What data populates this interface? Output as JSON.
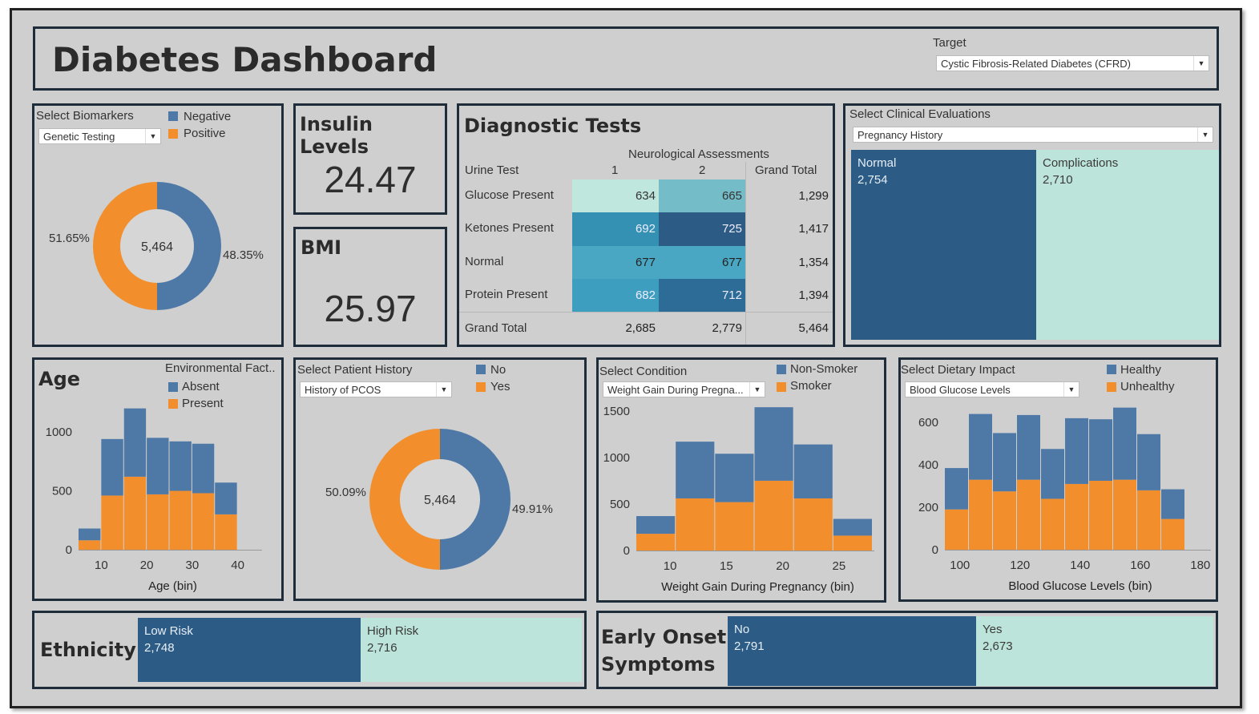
{
  "header": {
    "title": "Diabetes Dashboard",
    "target_label": "Target",
    "target_value": "Cystic Fibrosis-Related Diabetes (CFRD)"
  },
  "biomarkers": {
    "label": "Select Biomarkers",
    "dropdown": "Genetic Testing",
    "legend": [
      "Negative",
      "Positive"
    ],
    "total": "5,464",
    "pct_positive": "51.65%",
    "pct_negative": "48.35%",
    "share_negative": 0.4835
  },
  "insulin": {
    "title": "Insulin Levels",
    "value": "24.47"
  },
  "bmi": {
    "title": "BMI",
    "value": "25.97"
  },
  "diagnostic": {
    "title": "Diagnostic Tests",
    "col_group": "Neurological Assessments",
    "row_header": "Urine Test",
    "cols": [
      "1",
      "2",
      "Grand Total"
    ],
    "rows": [
      {
        "name": "Glucose Present",
        "v1": "634",
        "v2": "665",
        "total": "1,299"
      },
      {
        "name": "Ketones Present",
        "v1": "692",
        "v2": "725",
        "total": "1,417"
      },
      {
        "name": "Normal",
        "v1": "677",
        "v2": "677",
        "total": "1,354"
      },
      {
        "name": "Protein Present",
        "v1": "682",
        "v2": "712",
        "total": "1,394"
      }
    ],
    "grand_total_label": "Grand Total",
    "grand": {
      "v1": "2,685",
      "v2": "2,779",
      "total": "5,464"
    }
  },
  "clinical": {
    "label": "Select Clinical Evaluations",
    "dropdown": "Pregnancy History",
    "items": [
      {
        "name": "Normal",
        "value": "2,754"
      },
      {
        "name": "Complications",
        "value": "2,710"
      }
    ]
  },
  "age": {
    "title": "Age",
    "legend_title": "Environmental Fact..",
    "legend": [
      "Absent",
      "Present"
    ]
  },
  "patient_history": {
    "label": "Select Patient History",
    "dropdown": "History of PCOS",
    "legend": [
      "No",
      "Yes"
    ],
    "total": "5,464",
    "pct_yes": "50.09%",
    "pct_no": "49.91%",
    "share_no": 0.4991
  },
  "condition": {
    "label": "Select Condition",
    "dropdown": "Weight Gain During Pregna...",
    "legend": [
      "Non-Smoker",
      "Smoker"
    ]
  },
  "dietary": {
    "label": "Select Dietary Impact",
    "dropdown": "Blood Glucose Levels",
    "legend": [
      "Healthy",
      "Unhealthy"
    ]
  },
  "ethnicity": {
    "title": "Ethnicity",
    "items": [
      {
        "name": "Low Risk",
        "value": "2,748"
      },
      {
        "name": "High Risk",
        "value": "2,716"
      }
    ]
  },
  "early_onset": {
    "title_line1": "Early Onset",
    "title_line2": "Symptoms",
    "items": [
      {
        "name": "No",
        "value": "2,791"
      },
      {
        "name": "Yes",
        "value": "2,673"
      }
    ]
  },
  "colors": {
    "blue": "#4e79a7",
    "orange": "#f28e2b",
    "navy": "#2c5b85",
    "mint": "#bce4da"
  },
  "chart_data": [
    {
      "type": "bar",
      "stacked": true,
      "xlabel": "Age (bin)",
      "x_ticks": [
        10,
        20,
        30,
        40
      ],
      "y_ticks": [
        0,
        500,
        1000
      ],
      "ylim": [
        0,
        1150
      ],
      "bins": [
        5,
        10,
        15,
        20,
        25,
        30,
        35,
        40
      ],
      "bin_width": 5,
      "series": [
        {
          "name": "Present",
          "values": [
            80,
            460,
            620,
            470,
            500,
            480,
            300,
            0
          ]
        },
        {
          "name": "Absent",
          "values": [
            100,
            480,
            580,
            480,
            420,
            420,
            270,
            0
          ]
        }
      ]
    },
    {
      "type": "bar",
      "stacked": true,
      "xlabel": "Weight Gain During Pregnancy (bin)",
      "x_ticks": [
        10,
        15,
        20,
        25
      ],
      "y_ticks": [
        0,
        500,
        1000,
        1500
      ],
      "ylim": [
        0,
        1550
      ],
      "bins": [
        7,
        10.5,
        14,
        17.5,
        21,
        24.5
      ],
      "bin_width": 3.5,
      "series": [
        {
          "name": "Smoker",
          "values": [
            180,
            560,
            520,
            750,
            560,
            160
          ]
        },
        {
          "name": "Non-Smoker",
          "values": [
            190,
            610,
            520,
            790,
            580,
            180
          ]
        }
      ]
    },
    {
      "type": "bar",
      "stacked": true,
      "xlabel": "Blood Glucose Levels (bin)",
      "x_ticks": [
        100,
        120,
        140,
        160,
        180
      ],
      "y_ticks": [
        0,
        200,
        400,
        600
      ],
      "ylim": [
        0,
        680
      ],
      "bins": [
        95,
        103,
        111,
        119,
        127,
        135,
        143,
        151,
        159,
        167,
        175
      ],
      "bin_width": 8,
      "series": [
        {
          "name": "Unhealthy",
          "values": [
            190,
            330,
            275,
            330,
            240,
            310,
            325,
            330,
            280,
            145
          ]
        },
        {
          "name": "Healthy",
          "values": [
            195,
            310,
            275,
            305,
            235,
            310,
            290,
            340,
            265,
            140
          ]
        }
      ]
    }
  ]
}
